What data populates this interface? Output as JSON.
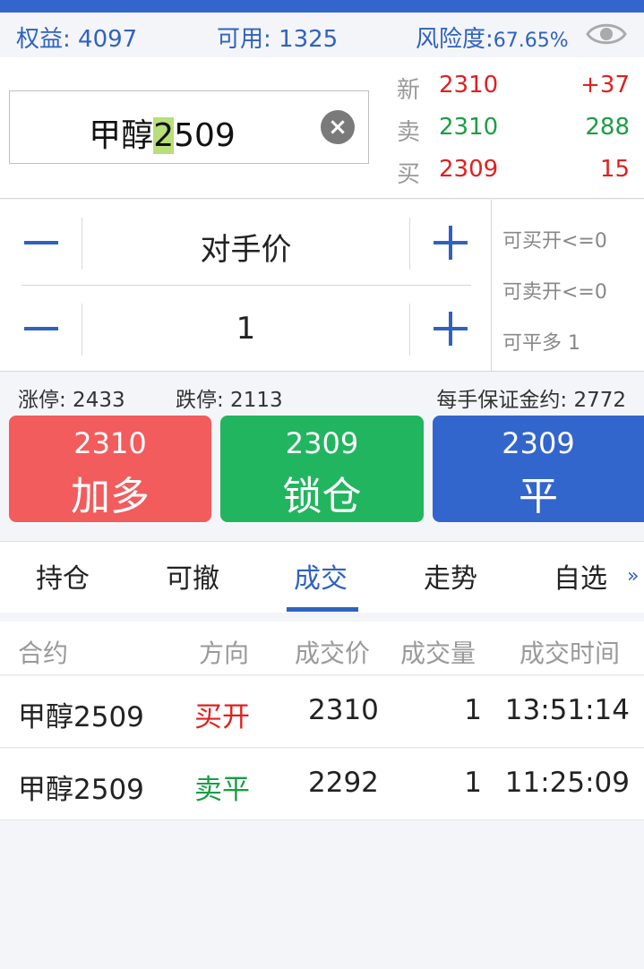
{
  "account": {
    "equity": "权益: 4097",
    "available": "可用: 1325",
    "risk_label": "风险度:",
    "risk_value": "67.65%",
    "eye_icon": "eye-icon"
  },
  "symbol": {
    "prefix": "甲醇",
    "highlight": "2",
    "suffix": "509",
    "clear_icon": "close-circle-icon"
  },
  "quote": {
    "last": {
      "label": "新",
      "price": "2310",
      "change": "+37"
    },
    "ask": {
      "label": "卖",
      "price": "2310",
      "volume": "288"
    },
    "bid": {
      "label": "买",
      "price": "2309",
      "volume": "15"
    }
  },
  "order": {
    "price_mode": "对手价",
    "quantity": "1",
    "can_buy_open": "可买开<=0",
    "can_sell_open": "可卖开<=0",
    "can_close_long": "可平多 1"
  },
  "limits": {
    "limit_up": "涨停: 2433",
    "limit_down": "跌停: 2113",
    "margin": "每手保证金约: 2772"
  },
  "buttons": {
    "buy": {
      "price": "2310",
      "label": "加多"
    },
    "lock": {
      "price": "2309",
      "label": "锁仓"
    },
    "close": {
      "price": "2309",
      "label": "平"
    }
  },
  "tabs": [
    "持仓",
    "可撤",
    "成交",
    "走势",
    "自选"
  ],
  "tabs_more": "»",
  "active_tab": "成交",
  "trades": {
    "columns": [
      "合约",
      "方向",
      "成交价",
      "成交量",
      "成交时间"
    ],
    "rows": [
      {
        "contract": "甲醇2509",
        "direction": "买开",
        "price": "2310",
        "volume": "1",
        "time": "13:51:14"
      },
      {
        "contract": "甲醇2509",
        "direction": "卖平",
        "price": "2292",
        "volume": "1",
        "time": "11:25:09"
      }
    ]
  },
  "colors": {
    "brand_blue": "#3366cc",
    "up_red": "#e02020",
    "down_green": "#1b9e43",
    "buy_button": "#f25c5c",
    "lock_button": "#22b55f"
  }
}
